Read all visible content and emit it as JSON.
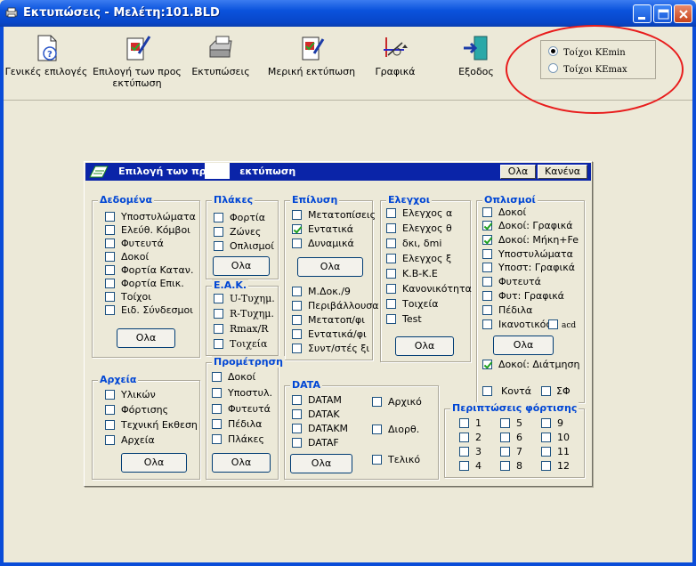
{
  "window": {
    "title": "Εκτυπώσεις - Μελέτη:101.BLD"
  },
  "toolbar": {
    "general": "Γενικές επιλογές",
    "select_print_1": "Επιλογή των προς",
    "select_print_2": "εκτύπωση",
    "prints": "Εκτυπώσεις",
    "partial": "Μερική εκτύπωση",
    "graphics": "Γραφικά",
    "exit": "Εξοδος"
  },
  "walls_option": {
    "kemin": "Τοίχοι ΚΕmin",
    "kemax": "Τοίχοι ΚΕmax",
    "selected": "kemin"
  },
  "dialog": {
    "title": "Επιλογή των προ",
    "title_tail": "εκτύπωση",
    "ok_label": "Ολα",
    "cancel_label": "Κανένα"
  },
  "groups": {
    "dedomena": {
      "title": "Δεδομένα",
      "items": [
        "Υποστυλώματα",
        "Ελεύθ. Κόμβοι",
        "Φυτευτά",
        "Δοκοί",
        "Φορτία Καταν.",
        "Φορτία Επικ.",
        "Τοίχοι",
        "Ειδ. Σύνδεσμοι"
      ],
      "button": "Ολα"
    },
    "plakes": {
      "title": "Πλάκες",
      "items": [
        "Φορτία",
        "Ζώνες",
        "Οπλισμοί"
      ],
      "button": "Ολα"
    },
    "eak": {
      "title": "Ε.Α.Κ.",
      "items": [
        "U-Τυχημ.",
        "R-Τυχημ.",
        "Rmax/R",
        "Τοιχεία"
      ]
    },
    "epilysi": {
      "title": "Επίλυση",
      "items": [
        "Μετατοπίσεις",
        "Εντατικά",
        "Δυναμικά"
      ],
      "checked": [
        false,
        true,
        false
      ],
      "button": "Ολα",
      "items2": [
        "Μ.Δοκ./9",
        "Περιβάλλουσα",
        "Μετατοπ/φι",
        "Εντατικά/φι",
        "Συντ/στές ξι"
      ]
    },
    "elegxoi": {
      "title": "Ελεγχοι",
      "items": [
        "Ελεγχος α",
        "Ελεγχος θ",
        "δκι, δmi",
        "Ελεγχος ξ",
        "Κ.Β-Κ.Ε",
        "Κανονικότητα",
        "Τοιχεία",
        "Test"
      ],
      "button": "Ολα"
    },
    "oplismoi": {
      "title": "Οπλισμοί",
      "items": [
        "Δοκοί",
        "Δοκοί: Γραφικά",
        "Δοκοί: Μήκη+Fe",
        "Υποστυλώματα",
        "Υποστ: Γραφικά",
        "Φυτευτά",
        "Φυτ: Γραφικά",
        "Πέδιλα",
        "Ικανοτικός"
      ],
      "checked": [
        false,
        true,
        true,
        false,
        false,
        false,
        false,
        false,
        false
      ],
      "acd": "acd",
      "button": "Ολα",
      "diatmisi": "Δοκοί: Διάτμηση",
      "konta": "Κοντά",
      "sf": "ΣΦ"
    },
    "arxeia": {
      "title": "Αρχεία",
      "items": [
        "Υλικών",
        "Φόρτισης",
        "Τεχνική Εκθεση",
        "Αρχεία"
      ],
      "button": "Ολα"
    },
    "prometrisi": {
      "title": "Προμέτρηση",
      "items": [
        "Δοκοί",
        "Υποστυλ.",
        "Φυτευτά",
        "Πέδιλα",
        "Πλάκες"
      ],
      "button": "Ολα"
    },
    "data": {
      "title": "DATA",
      "items": [
        "DATAM",
        "DATAK",
        "DATAKM",
        "DATAF"
      ],
      "right": [
        "Αρχικό",
        "Διορθ.",
        "Τελικό"
      ],
      "button": "Ολα"
    },
    "loadcases": {
      "title": "Περιπτώσεις φόρτισης",
      "col1": [
        "1",
        "2",
        "3",
        "4"
      ],
      "col2": [
        "5",
        "6",
        "7",
        "8"
      ],
      "col3": [
        "9",
        "10",
        "11",
        "12"
      ]
    }
  }
}
